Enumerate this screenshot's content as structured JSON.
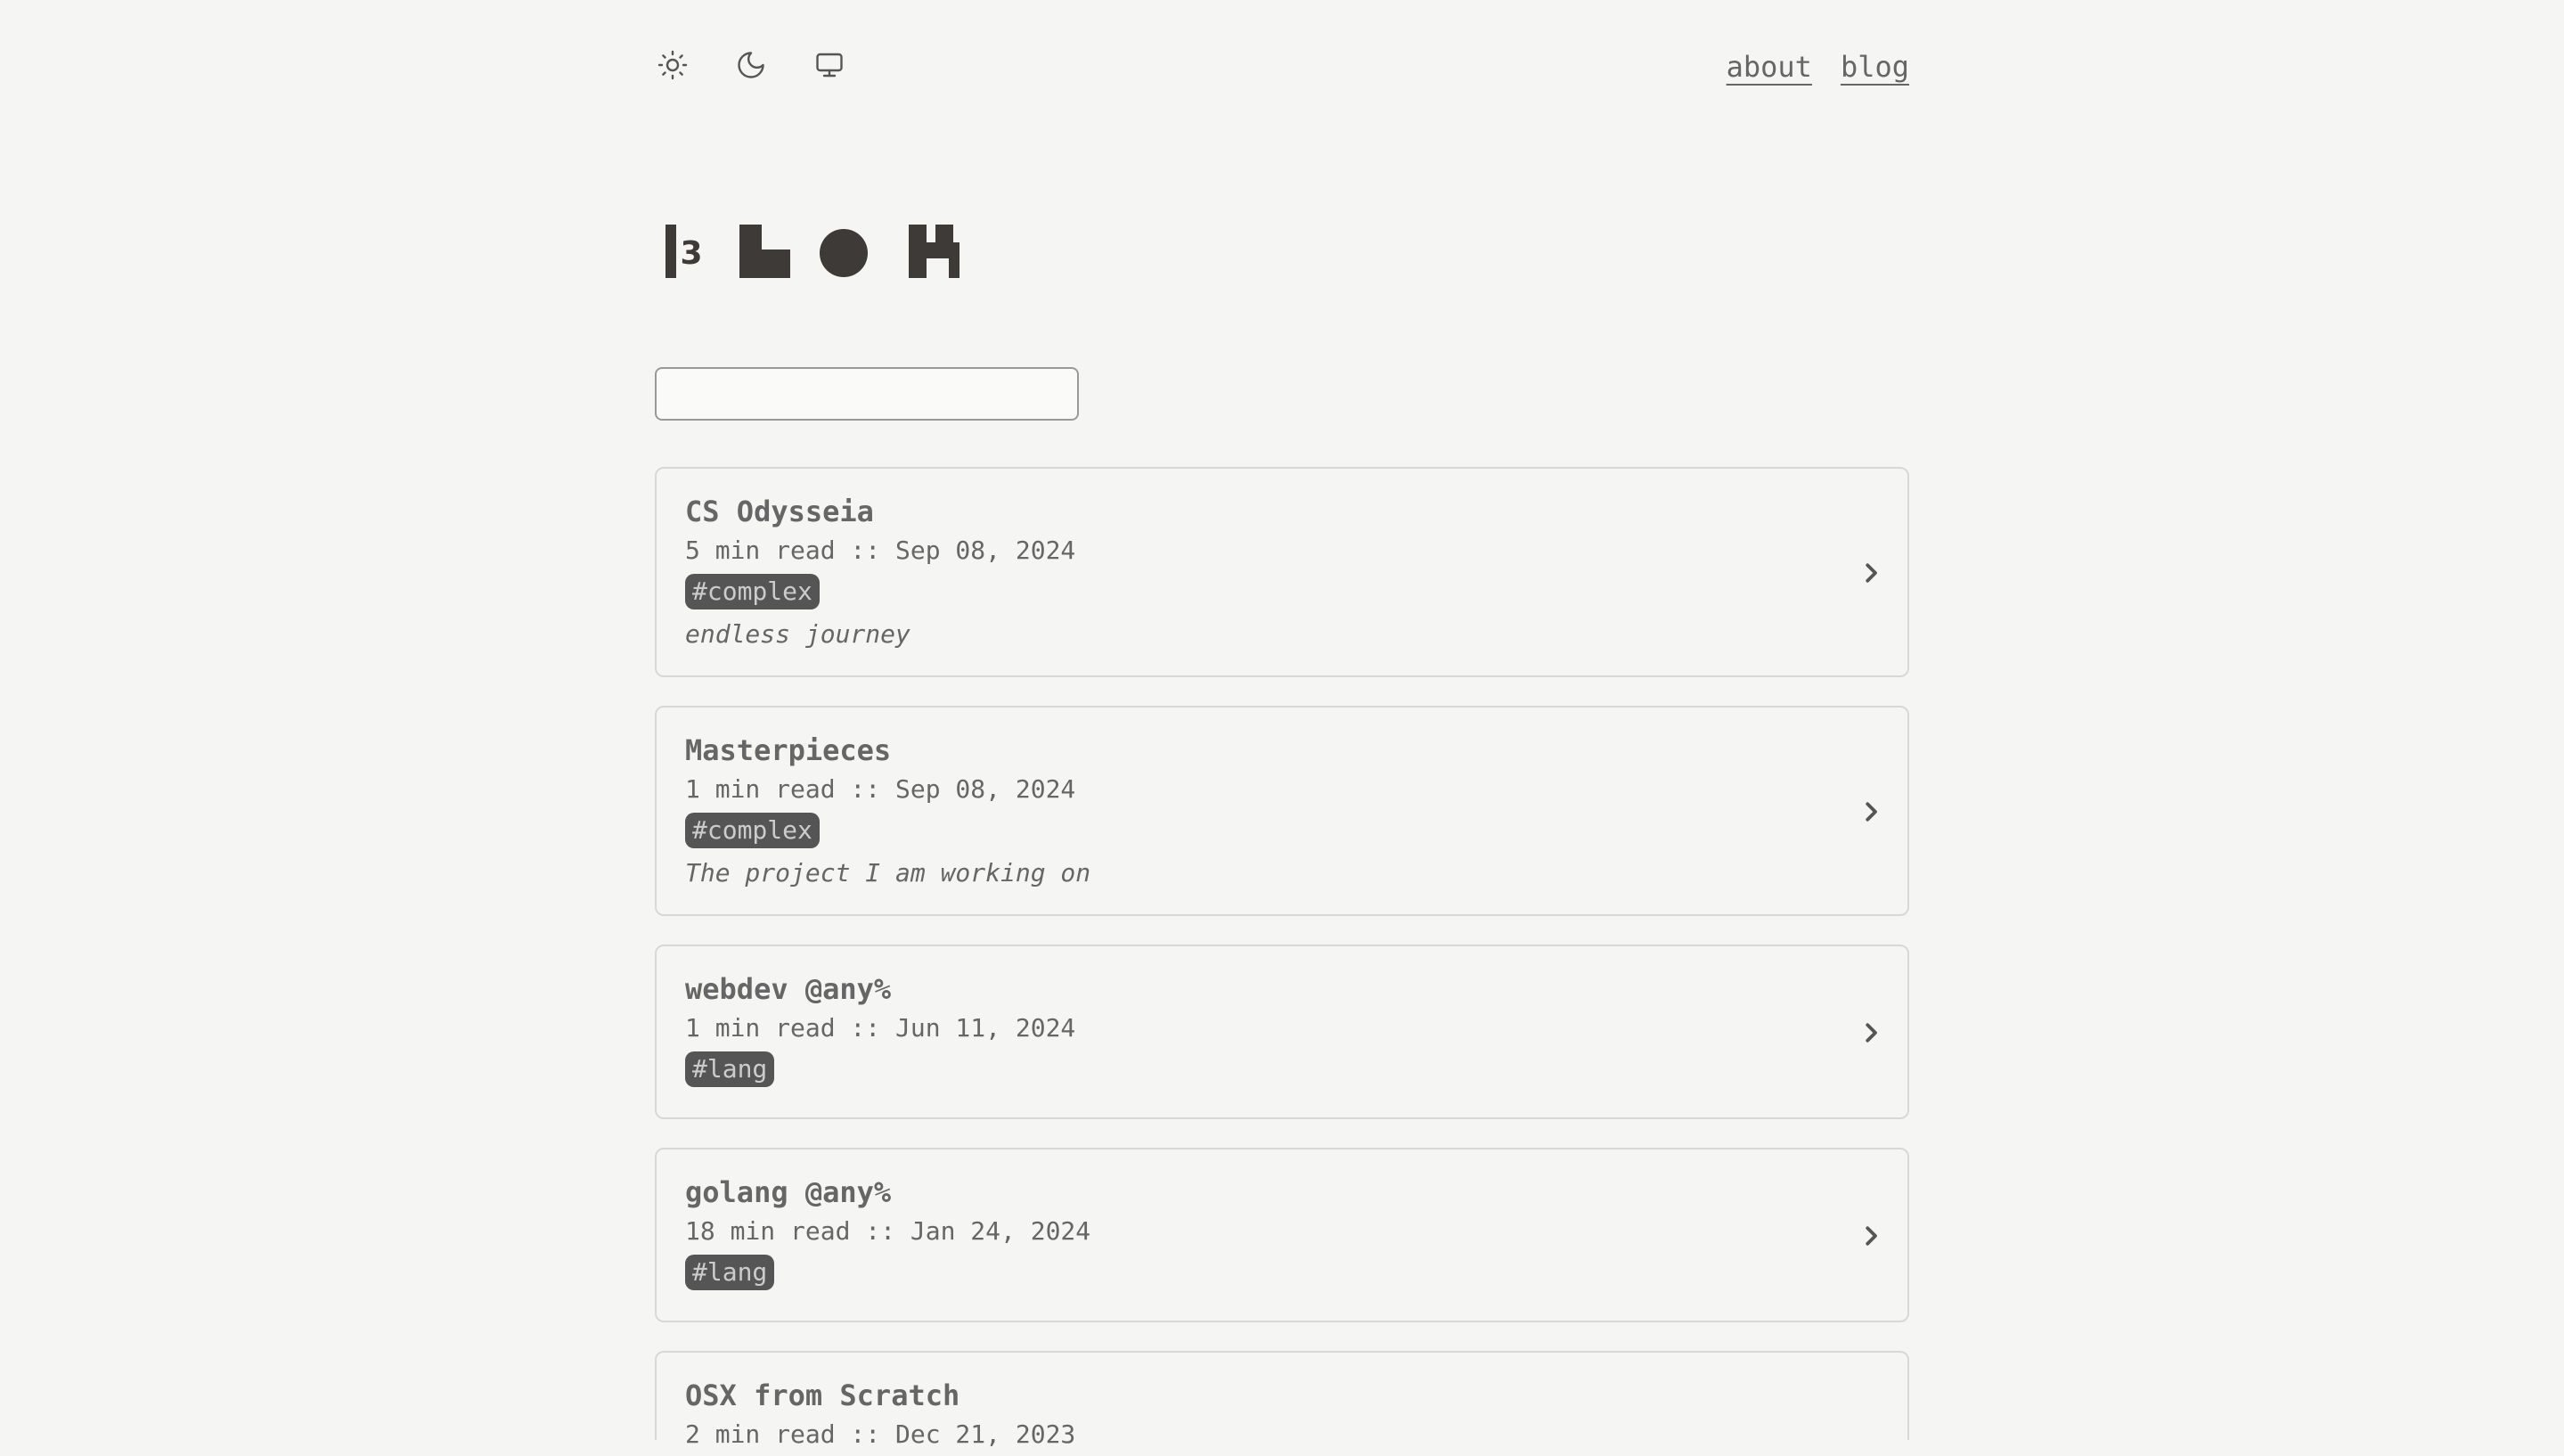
{
  "theme_toggle": {
    "light_icon": "sun-icon",
    "dark_icon": "moon-icon",
    "system_icon": "monitor-icon"
  },
  "nav": {
    "about": "about",
    "blog": "blog"
  },
  "logo": {
    "text": "3"
  },
  "search": {
    "placeholder": "",
    "value": ""
  },
  "posts": [
    {
      "title": "CS Odysseia",
      "meta": "5 min read :: Sep 08, 2024",
      "tag": "#complex",
      "description": "endless journey"
    },
    {
      "title": "Masterpieces",
      "meta": "1 min read :: Sep 08, 2024",
      "tag": "#complex",
      "description": "The project I am working on"
    },
    {
      "title": "webdev @any%",
      "meta": "1 min read :: Jun 11, 2024",
      "tag": "#lang",
      "description": ""
    },
    {
      "title": "golang @any%",
      "meta": "18 min read :: Jan 24, 2024",
      "tag": "#lang",
      "description": ""
    },
    {
      "title": "OSX from Scratch",
      "meta": "2 min read :: Dec 21, 2023",
      "tag": "",
      "description": ""
    }
  ],
  "colors": {
    "background": "#f5f5f3",
    "text": "#666666",
    "tag_bg": "#555555",
    "border": "#d8d8d6"
  }
}
